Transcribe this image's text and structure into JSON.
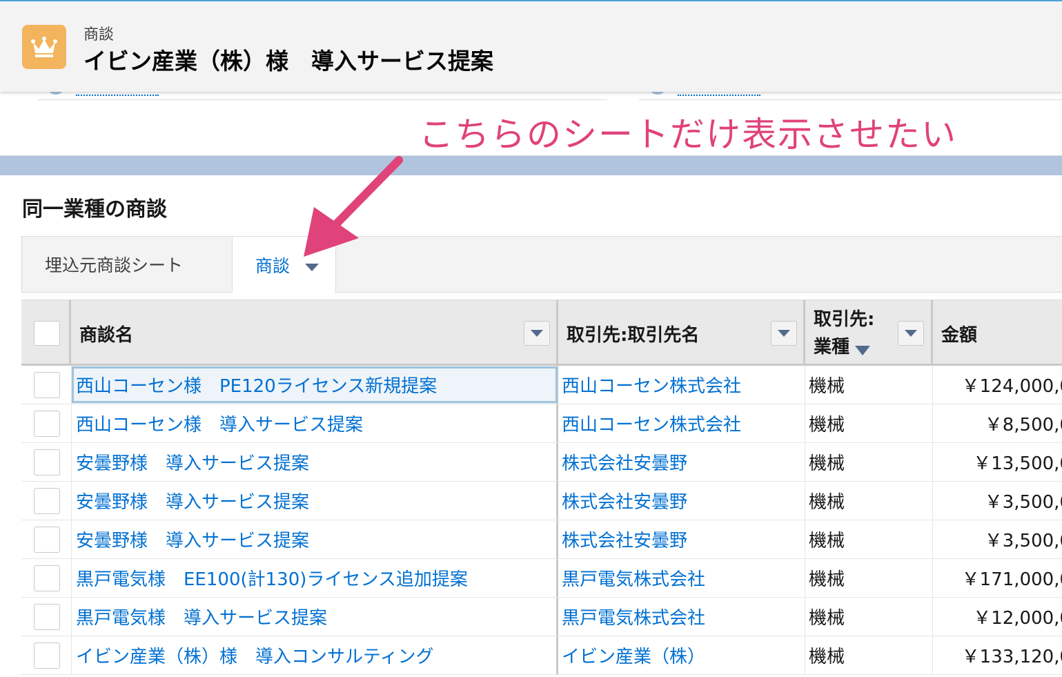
{
  "header": {
    "object_label": "商談",
    "record_title": "イビン産業（株）様　導入サービス提案"
  },
  "annotation": {
    "text": "こちらのシートだけ表示させたい",
    "color": "#e0427a"
  },
  "section": {
    "title": "同一業種の商談"
  },
  "tabs": [
    {
      "label": "埋込元商談シート",
      "active": false
    },
    {
      "label": "商談",
      "active": true
    }
  ],
  "table": {
    "columns": {
      "name": "商談名",
      "account_line1": "取引先:取引先名",
      "industry_line1": "取引先:",
      "industry_line2": "業種",
      "amount": "金額"
    },
    "rows": [
      {
        "name": "西山コーセン様　PE120ライセンス新規提案",
        "account": "西山コーセン株式会社",
        "industry": "機械",
        "amount": "￥124,000,0"
      },
      {
        "name": "西山コーセン様　導入サービス提案",
        "account": "西山コーセン株式会社",
        "industry": "機械",
        "amount": "￥8,500,0"
      },
      {
        "name": "安曇野様　導入サービス提案",
        "account": "株式会社安曇野",
        "industry": "機械",
        "amount": "￥13,500,0"
      },
      {
        "name": "安曇野様　導入サービス提案",
        "account": "株式会社安曇野",
        "industry": "機械",
        "amount": "￥3,500,0"
      },
      {
        "name": "安曇野様　導入サービス提案",
        "account": "株式会社安曇野",
        "industry": "機械",
        "amount": "￥3,500,0"
      },
      {
        "name": "黒戸電気様　EE100(計130)ライセンス追加提案",
        "account": "黒戸電気株式会社",
        "industry": "機械",
        "amount": "￥171,000,0"
      },
      {
        "name": "黒戸電気様　導入サービス提案",
        "account": "黒戸電気株式会社",
        "industry": "機械",
        "amount": "￥12,000,0"
      },
      {
        "name": "イビン産業（株）様　導入コンサルティング",
        "account": "イビン産業（株）",
        "industry": "機械",
        "amount": "￥133,120,0"
      }
    ]
  },
  "colors": {
    "link": "#0070d2",
    "header_icon": "#f2b45d",
    "active_tab_text": "#0070d2"
  },
  "icons": {
    "header": "crown-icon",
    "column_menu": "chevron-down-icon",
    "filter": "filter-icon"
  }
}
